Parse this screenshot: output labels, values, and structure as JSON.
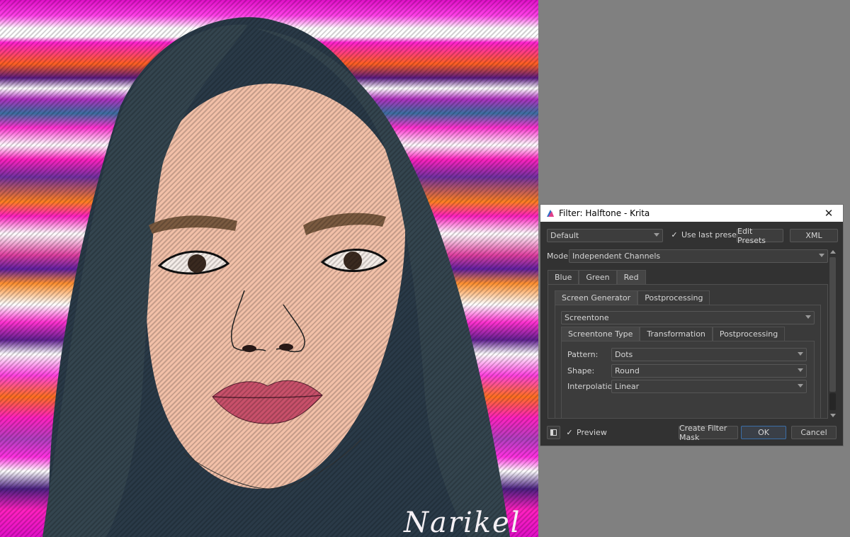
{
  "canvas": {
    "signature": "Narikel"
  },
  "dialog": {
    "title": "Filter: Halftone - Krita",
    "preset": {
      "selected": "Default",
      "use_last_preset_label": "Use last preset",
      "use_last_preset_checked": true,
      "edit_presets_label": "Edit Presets",
      "xml_label": "XML"
    },
    "mode": {
      "label": "Mode:",
      "value": "Independent Channels"
    },
    "channel_tabs": [
      "Blue",
      "Green",
      "Red"
    ],
    "active_channel_tab": "Red",
    "generator_tabs": [
      "Screen Generator",
      "Postprocessing"
    ],
    "generator": {
      "value": "Screentone"
    },
    "screentone_tabs": [
      "Screentone Type",
      "Transformation",
      "Postprocessing"
    ],
    "screentone": {
      "pattern_label": "Pattern:",
      "pattern_value": "Dots",
      "shape_label": "Shape:",
      "shape_value": "Round",
      "interpolation_label": "Interpolation:",
      "interpolation_value": "Linear"
    },
    "footer": {
      "preview_label": "Preview",
      "preview_checked": true,
      "create_filter_mask_label": "Create Filter Mask",
      "ok_label": "OK",
      "cancel_label": "Cancel"
    }
  },
  "colors": {
    "dialog_bg": "#323232",
    "accent_border": "#3c6fa8",
    "desktop_bg": "#808080"
  }
}
